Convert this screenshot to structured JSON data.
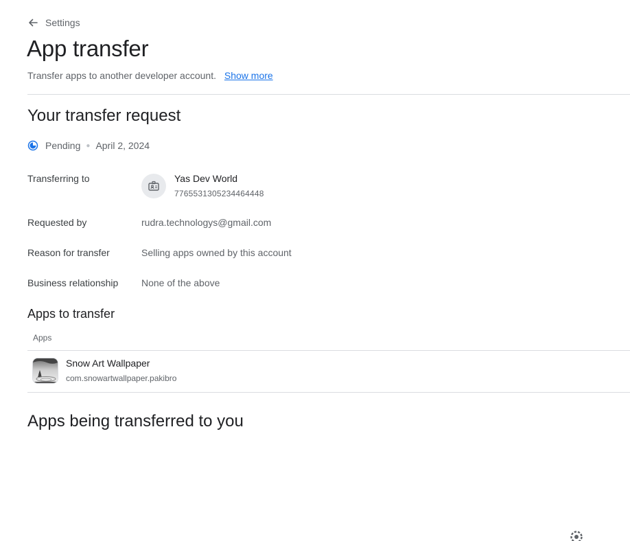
{
  "breadcrumb": {
    "label": "Settings",
    "icon": "arrow-back-icon"
  },
  "page": {
    "title": "App transfer",
    "subtitle": "Transfer apps to another developer account.",
    "show_more": "Show more"
  },
  "request": {
    "title": "Your transfer request",
    "status": "Pending",
    "date": "April 2, 2024",
    "status_icon": "pending-clock-icon",
    "transferring_to_label": "Transferring to",
    "account_name": "Yas Dev World",
    "account_id": "7765531305234464448",
    "requested_by_label": "Requested by",
    "requested_by": "rudra.technologys@gmail.com",
    "reason_label": "Reason for transfer",
    "reason": "Selling apps owned by this account",
    "relationship_label": "Business relationship",
    "relationship": "None of the above"
  },
  "apps_section": {
    "title": "Apps to transfer",
    "column_header": "Apps",
    "apps": [
      {
        "name": "Snow Art Wallpaper",
        "package": "com.snowartwallpaper.pakibro"
      }
    ]
  },
  "incoming": {
    "title": "Apps being transferred to you"
  },
  "colors": {
    "link": "#1a73e8",
    "pending": "#1a73e8",
    "divider": "#dadce0"
  }
}
